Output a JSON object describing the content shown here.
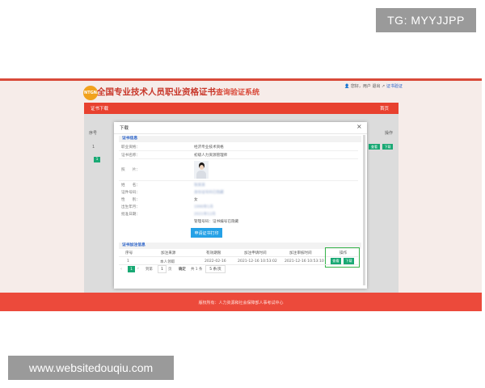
{
  "watermarks": {
    "top_right": "TG: MYYJJPP",
    "bottom_left": "www.websitedouqiu.com"
  },
  "site": {
    "logo_text": "NTGN",
    "title": "全国专业技术人员职业资格证书",
    "title_suffix": "查询验证系统",
    "header_links": {
      "user": "您好，用户",
      "logout": "退出",
      "verify": "证书验证"
    }
  },
  "nav": {
    "left": "证书下载",
    "right": "首页"
  },
  "background_table": {
    "col_seq": "序号",
    "col_op": "操作",
    "row_num": "1",
    "page": "1",
    "btn_view": "查看",
    "btn_download": "下载"
  },
  "modal": {
    "title": "下载",
    "close": "×",
    "cert_section": "证书信息",
    "fields": [
      {
        "label": "职业资格：",
        "value": "经济专业技术资格"
      },
      {
        "label": "证书名称：",
        "value": "初级人力资源管理师"
      },
      {
        "label": "照　　片：",
        "value": ""
      },
      {
        "label": "姓　　名：",
        "value": "张某某"
      },
      {
        "label": "证件号码：",
        "value": "身份证号码已隐藏"
      },
      {
        "label": "性　　别：",
        "value": "女"
      },
      {
        "label": "出生年月：",
        "value": "1990年1月"
      },
      {
        "label": "批准日期：",
        "value": "2021年12月"
      },
      {
        "label": "",
        "value": "管理号码：证书编号已隐藏"
      }
    ],
    "apply_button": "申请证书打印",
    "record_section": "证书加注信息",
    "record_headers": [
      "序号",
      "加注来源",
      "有效期限",
      "加注申请时间",
      "加注审核时间",
      "操作"
    ],
    "record_row": [
      "1",
      "本人领取",
      "2022-02-16",
      "2021-12-16 10:53:02",
      "2021-12-16 10:53:10"
    ],
    "op_buttons": {
      "view": "查看",
      "download": "下载"
    },
    "pager": {
      "prev": "‹",
      "current": "1",
      "next": "›",
      "goto_label": "到第",
      "goto_value": "1",
      "page_unit": "页",
      "confirm": "确定",
      "total": "共 1 条",
      "per_page": "5 条/页"
    }
  },
  "footer": {
    "text": "版权所有：人力资源和社会保障部人事考试中心"
  },
  "colors": {
    "brand_red": "#e8412f",
    "green": "#19a974",
    "blue": "#25a1e6",
    "highlight": "#35b34a"
  }
}
